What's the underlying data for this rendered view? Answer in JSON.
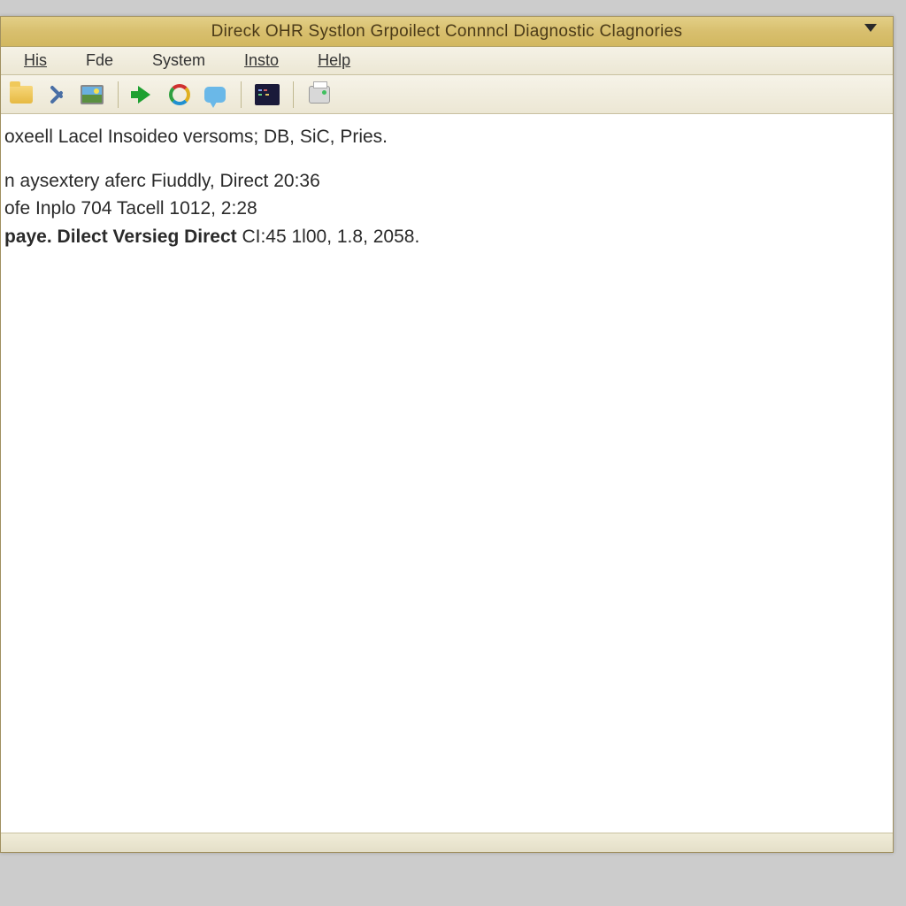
{
  "titlebar": {
    "title": "Direck OHR Systlon Grpoilect Connncl Diagnostic Clagnories"
  },
  "menubar": {
    "items": [
      "His",
      "Fde",
      "System",
      "Insto",
      "Help"
    ]
  },
  "toolbar": {
    "icons": [
      "folder",
      "tools",
      "picture",
      "arrow",
      "refresh",
      "chat",
      "terminal",
      "print"
    ]
  },
  "content": {
    "line1": "oxeell Lacel Insoideo versoms; DB, SiC, Pries.",
    "line2": "n aysextery aferc Fiuddly, Direct 20:36",
    "line3": "ofe Inplo 704 Tacell  1012, 2:28",
    "line4_bold": "paye. Dilect Versieg Direct",
    "line4_rest": " CI:45 1l00, 1.8, 2058."
  }
}
